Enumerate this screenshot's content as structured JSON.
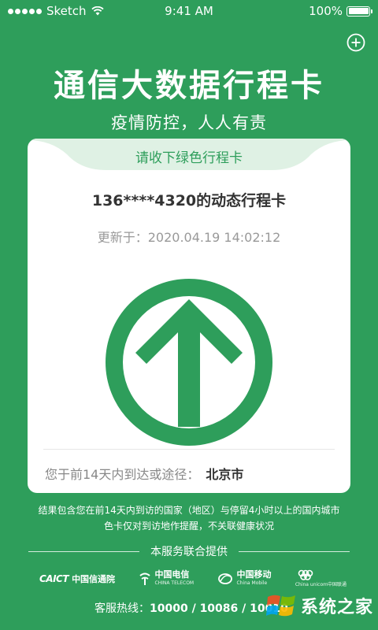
{
  "status_bar": {
    "carrier": "Sketch",
    "time": "9:41 AM",
    "battery": "100%"
  },
  "header": {
    "title": "通信大数据行程卡",
    "subtitle": "疫情防控，人人有责"
  },
  "card": {
    "tab_label": "请收下绿色行程卡",
    "phone_line": "136****4320的动态行程卡",
    "updated_label": "更新于：",
    "updated_time": "2020.04.19 14:02:12",
    "status_color": "#2e9e5b",
    "route_label": "您于前14天内到达或途径：",
    "route_city": "北京市"
  },
  "footer": {
    "disclaimer_line1": "结果包含您在前14天内到访的国家（地区）与停留4小时以上的国内城市",
    "disclaimer_line2": "色卡仅对到访地作提醒，不关联健康状况",
    "provider_label": "本服务联合提供",
    "logos": {
      "caict_mark": "CAICT",
      "caict_name": "中国信通院",
      "telecom_name": "中国电信",
      "telecom_sub": "CHINA TELECOM",
      "mobile_name": "中国移动",
      "mobile_sub": "China Mobile",
      "unicom_name": "China unicom中国联通"
    },
    "hotline_label": "客服热线：",
    "hotline_numbers": "10000 / 10086 / 10010",
    "watermark": "系统之家"
  },
  "colors": {
    "background": "#2e9e5b",
    "card": "#ffffff",
    "tab": "#dff1e4"
  }
}
